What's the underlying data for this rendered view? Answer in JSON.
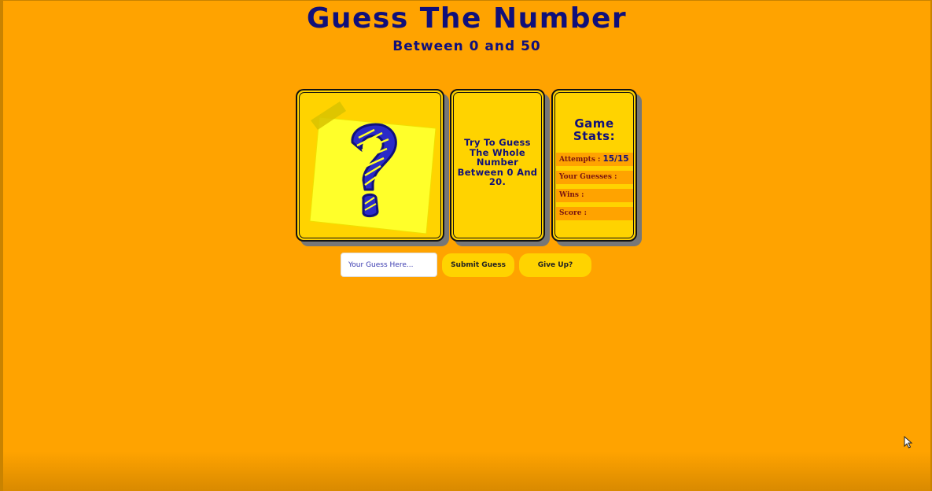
{
  "header": {
    "title": "Guess The Number",
    "subtitle": "Between 0 and 50"
  },
  "cards": {
    "mystery": {
      "icon": "question-mark-sticky-note-icon"
    },
    "message": "Try To Guess The Whole Number Between 0 And 20.",
    "stats": {
      "title": "Game Stats:",
      "attempts_label": "Attempts : ",
      "attempts_value": "15/15",
      "guesses_label": "Your Guesses :",
      "wins_label": "Wins :",
      "score_label": "Score :"
    }
  },
  "controls": {
    "input_placeholder": "Your Guess Here...",
    "input_value": "",
    "submit_label": "Submit Guess",
    "giveup_label": "Give Up?"
  },
  "colors": {
    "background": "#ffa300",
    "card": "#ffd300",
    "text": "#10107a",
    "sticky_note": "#ffff2a"
  }
}
